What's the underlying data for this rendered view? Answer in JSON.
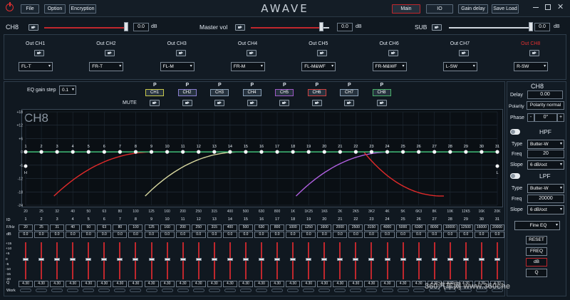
{
  "topbar": {
    "file": "File",
    "option": "Option",
    "encryption": "Encryption",
    "brand": "AWAVE",
    "main": "Main",
    "io": "IO",
    "gain_delay": "Gain delay",
    "save_load": "Save Load"
  },
  "volume": {
    "ch_label": "CH8",
    "ch_value": "0.0",
    "master_label": "Master vol",
    "master_value": "0.0",
    "sub_label": "SUB",
    "sub_value": "0.0",
    "unit": "dB"
  },
  "outputs": [
    {
      "label": "Out CH1",
      "assign": "FL-T"
    },
    {
      "label": "Out CH2",
      "assign": "FR-T"
    },
    {
      "label": "Out CH3",
      "assign": "FL-M"
    },
    {
      "label": "Out CH4",
      "assign": "FR-M"
    },
    {
      "label": "Out CH5",
      "assign": "FL-M&WF"
    },
    {
      "label": "Out CH6",
      "assign": "FR-M&WF"
    },
    {
      "label": "Out CH7",
      "assign": "L-SW"
    },
    {
      "label": "Out CH8",
      "assign": "R-SW"
    }
  ],
  "eq_step": {
    "label": "EQ gain step",
    "value": "0.1"
  },
  "mute_label": "MUTE",
  "p_label": "P",
  "channels": [
    {
      "name": "CH1",
      "color": "#c9c94a"
    },
    {
      "name": "CH2",
      "color": "#8a7fd0"
    },
    {
      "name": "CH3",
      "color": "#8aa0b6"
    },
    {
      "name": "CH4",
      "color": "#8aa0b6"
    },
    {
      "name": "CH5",
      "color": "#a05ac8"
    },
    {
      "name": "CH6",
      "color": "#d04040"
    },
    {
      "name": "CH7",
      "color": "#8aa0b6"
    },
    {
      "name": "CH8",
      "color": "#4ab06a"
    }
  ],
  "graph": {
    "title": "CH8",
    "yticks": [
      "+18",
      "+12",
      "+6",
      "0",
      "-6",
      "-12",
      "-18",
      "-24"
    ],
    "xticks": [
      "20",
      "25",
      "32",
      "40",
      "50",
      "63",
      "80",
      "100",
      "125",
      "160",
      "200",
      "250",
      "315",
      "400",
      "500",
      "630",
      "800",
      "1K",
      "1K25",
      "1K6",
      "2K",
      "2K5",
      "3K2",
      "4K",
      "5K",
      "6K3",
      "8K",
      "10K",
      "12K5",
      "16K",
      "20K"
    ],
    "h_label": "H",
    "l_label": "L"
  },
  "bands": {
    "id_label": "ID",
    "freq_label": "F/Hz",
    "db_label": "dB",
    "q_label": "Q",
    "work_label": "Work",
    "freqs": [
      "20",
      "25",
      "31",
      "40",
      "50",
      "63",
      "80",
      "100",
      "125",
      "160",
      "200",
      "250",
      "315",
      "400",
      "500",
      "630",
      "800",
      "1000",
      "1250",
      "1600",
      "2000",
      "2500",
      "3150",
      "4000",
      "5000",
      "6300",
      "8000",
      "10000",
      "12500",
      "16000",
      "20000"
    ],
    "db": "0.0",
    "q": "4.30",
    "fader_ticks": [
      "+15",
      "+10",
      "+5",
      "0",
      "-5",
      "-10",
      "-15",
      "-20"
    ]
  },
  "right": {
    "ch": "CH8",
    "delay_label": "Delay",
    "delay_value": "0.00",
    "polarity_label": "Polarity",
    "polarity_value": "Polarity normal",
    "phase_label": "Phase",
    "phase_value": "0°",
    "hpf": "HPF",
    "lpf": "LPF",
    "type_label": "Type",
    "freq_label": "Freq",
    "slope_label": "Slope",
    "hpf_type": "Butter-W",
    "hpf_freq": "20",
    "hpf_slope": "6 dB/oct",
    "lpf_type": "Butter-W",
    "lpf_freq": "20000",
    "lpf_slope": "6 dB/oct",
    "fine_eq": "Fine EQ",
    "reset": "RESET",
    "freq_btn": "FREQ",
    "db_btn": "dB",
    "q_btn": "Q"
  },
  "watermark": "360汽车网 www.360che"
}
